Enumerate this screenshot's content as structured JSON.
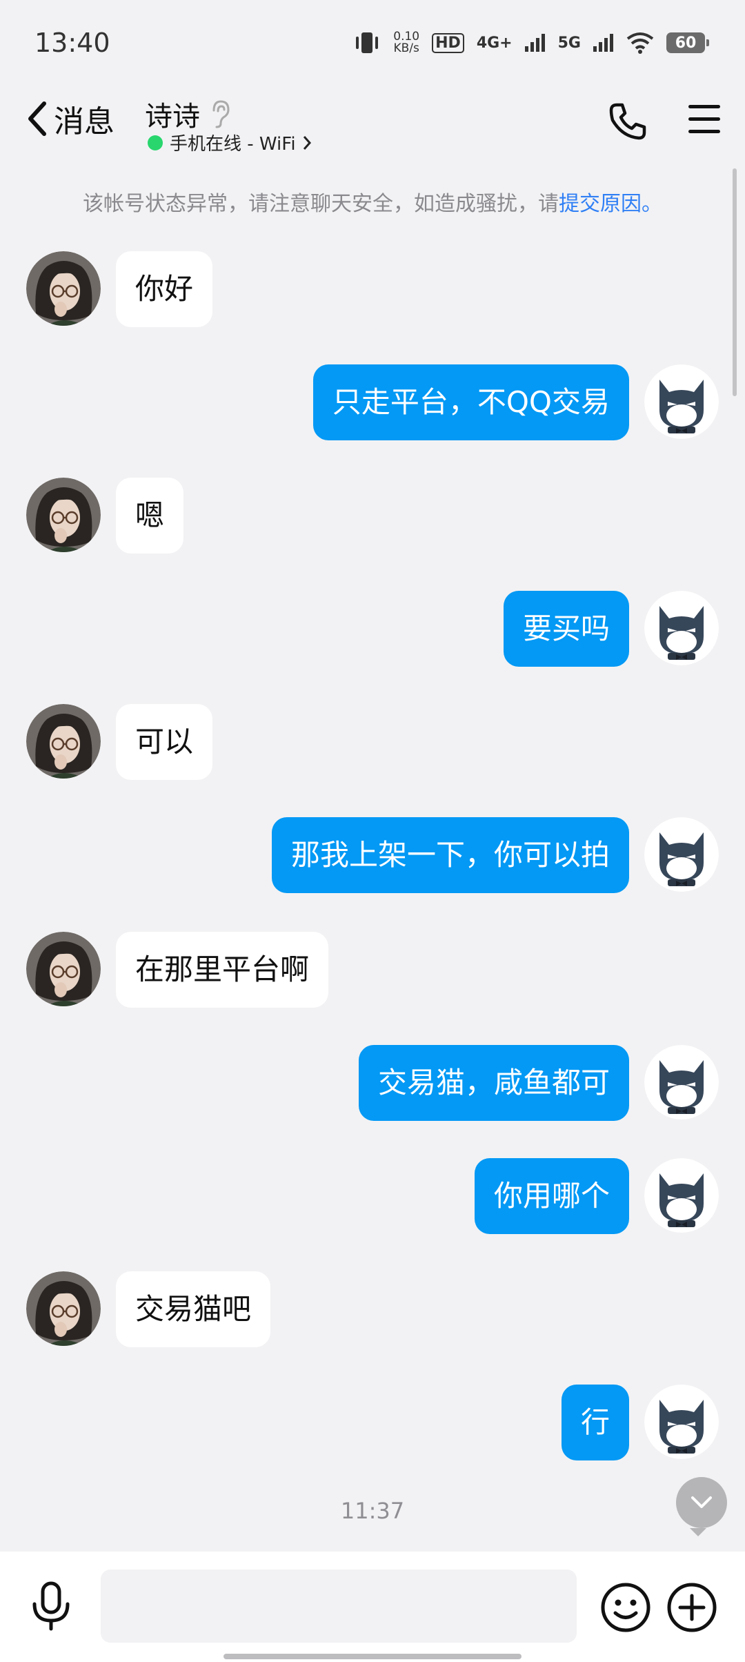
{
  "status_bar": {
    "time": "13:40",
    "net_speed_value": "0.10",
    "net_speed_unit": "KB/s",
    "hd_label": "HD",
    "lte_label": "4G+",
    "fiveg_label": "5G",
    "battery": "60"
  },
  "header": {
    "back_label": "消息",
    "contact_name": "诗诗",
    "presence": "手机在线 - WiFi"
  },
  "notice": {
    "text": "该帐号状态异常，请注意聊天安全，如造成骚扰，请",
    "link": "提交原因",
    "suffix": "。"
  },
  "messages": [
    {
      "side": "in",
      "text": "你好"
    },
    {
      "side": "out",
      "text": "只走平台，不QQ交易"
    },
    {
      "side": "in",
      "text": "嗯"
    },
    {
      "side": "out",
      "text": "要买吗"
    },
    {
      "side": "in",
      "text": "可以"
    },
    {
      "side": "out",
      "text": "那我上架一下，你可以拍"
    },
    {
      "side": "in",
      "text": "在那里平台啊"
    },
    {
      "side": "out",
      "text": "交易猫，咸鱼都可"
    },
    {
      "side": "out",
      "text": "你用哪个"
    },
    {
      "side": "in",
      "text": "交易猫吧"
    },
    {
      "side": "out",
      "text": "行"
    }
  ],
  "timestamp": "11:37",
  "input": {
    "value": "",
    "placeholder": ""
  },
  "colors": {
    "accent": "#0399f5",
    "online": "#28d66d",
    "link": "#2f7ff5",
    "background": "#f2f2f4"
  }
}
